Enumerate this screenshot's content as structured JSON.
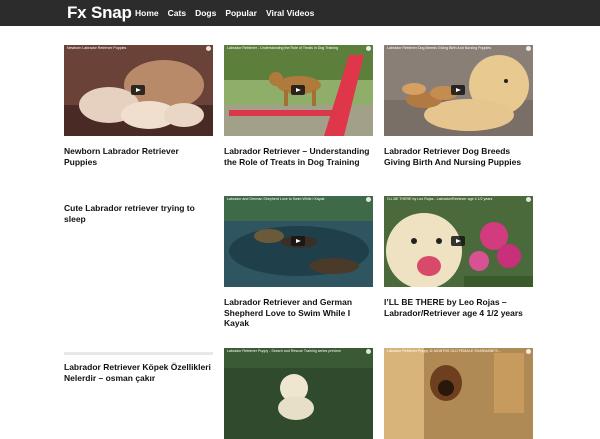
{
  "site": {
    "logo": "Fx Snap"
  },
  "nav": [
    "Home",
    "Cats",
    "Dogs",
    "Popular",
    "Viral Videos"
  ],
  "cards": [
    {
      "video_title": "Newborn Labrador Retriever Puppies",
      "title": "Newborn Labrador Retriever Puppies"
    },
    {
      "video_title": "Labrador Retriever - Understanding the Role of Treats in Dog Training",
      "title": "Labrador Retriever – Understanding the Role of Treats in Dog Training"
    },
    {
      "video_title": "Labrador Retriever Dog Breeds Giving Birth And Nursing Puppies",
      "title": "Labrador Retriever Dog Breeds Giving Birth And Nursing Puppies"
    },
    {
      "title": "Cute Labrador retriever trying to sleep"
    },
    {
      "video_title": "Labrador and German Shepherd Love to Swim While I Kayak",
      "title": "Labrador Retriever and German Shepherd Love to Swim While I Kayak"
    },
    {
      "video_title": "I'LL BE THERE by Leo Rojas - Labrador/Retriever age 4 1/2 years",
      "title": "I’LL BE THERE by Leo Rojas – Labrador/Retriever age 4 1/2 years"
    },
    {
      "title": "Labrador Retriever Köpek Özellikleri Nelerdir – osman çakır"
    },
    {
      "video_title": "Labrador Retriever Puppy - Search and Rescue Training series preview"
    },
    {
      "video_title": "Labrador Retriever Puppy 11 MONTHS OLD FEMALE SHARMANE'S..."
    }
  ]
}
